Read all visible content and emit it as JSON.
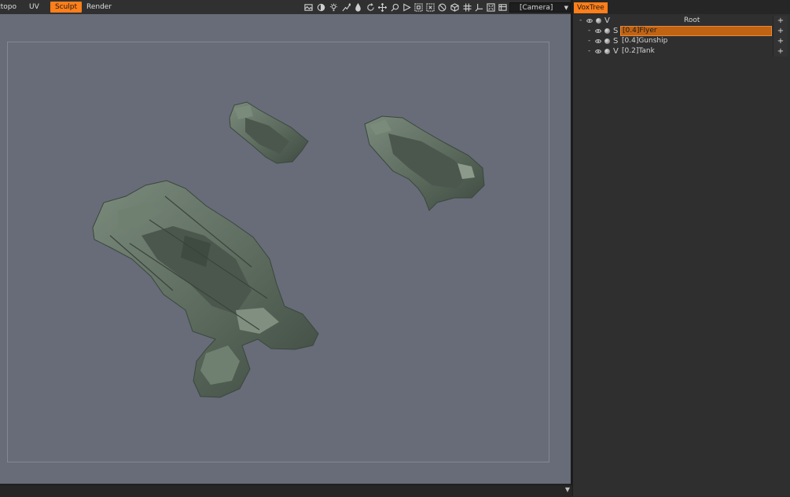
{
  "rooms": {
    "tabs": [
      {
        "label": "ztopo",
        "active": false
      },
      {
        "label": "UV",
        "active": false
      },
      {
        "label": "Sculpt",
        "active": true
      },
      {
        "label": "Render",
        "active": false
      }
    ]
  },
  "toolbar": {
    "icons": [
      "background-icon",
      "shading-icon",
      "light-icon",
      "lines-icon",
      "drop-icon",
      "rotate-icon",
      "move-icon",
      "zoom-icon",
      "play-icon",
      "box-icon",
      "box-alt-icon",
      "no-entry-icon",
      "cube-icon",
      "grid-icon",
      "axis-icon",
      "fit-view-icon",
      "render-region-icon"
    ],
    "camera_label": "[Camera]"
  },
  "panel": {
    "tab_label": "VoxTree",
    "add_label": "+",
    "collapse_label": "-",
    "rows": [
      {
        "type": "V",
        "name": "Root",
        "selected": false
      },
      {
        "type": "S",
        "name": "[0.4]Flyer",
        "selected": true
      },
      {
        "type": "S",
        "name": "[0.4]Gunship",
        "selected": false
      },
      {
        "type": "V",
        "name": "[0.2]Tank",
        "selected": false
      }
    ]
  },
  "colors": {
    "accent": "#ff7f1a",
    "viewport_bg": "#676c78",
    "model": "#5c6a5e"
  }
}
